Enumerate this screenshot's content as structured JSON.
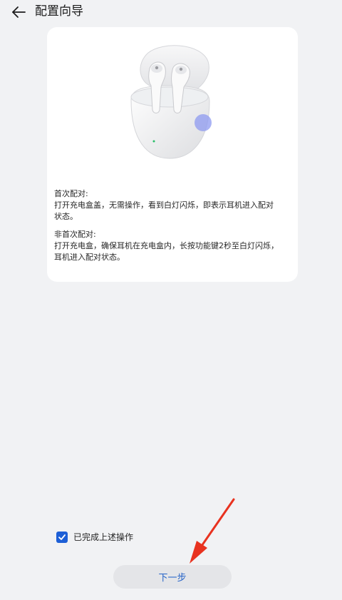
{
  "header": {
    "title": "配置向导",
    "back_icon": "arrow-left-icon"
  },
  "card": {
    "illustration": "earbuds-case-illustration",
    "first_pairing": {
      "heading": "首次配对:",
      "lines": [
        "打开充电盒盖，无需操作，看到白灯闪烁，即表示耳机进入配对",
        "状态。"
      ]
    },
    "non_first_pairing": {
      "heading": "非首次配对:",
      "lines": [
        "打开充电盒，确保耳机在充电盒内，长按功能键2秒至白灯闪烁，",
        "耳机进入配对状态。"
      ]
    }
  },
  "confirm": {
    "checked": true,
    "label": "已完成上述操作"
  },
  "next_button": {
    "label": "下一步"
  },
  "colors": {
    "background": "#f1f2f4",
    "accent": "#1d5fd6",
    "annotation_arrow": "#e8321f"
  }
}
